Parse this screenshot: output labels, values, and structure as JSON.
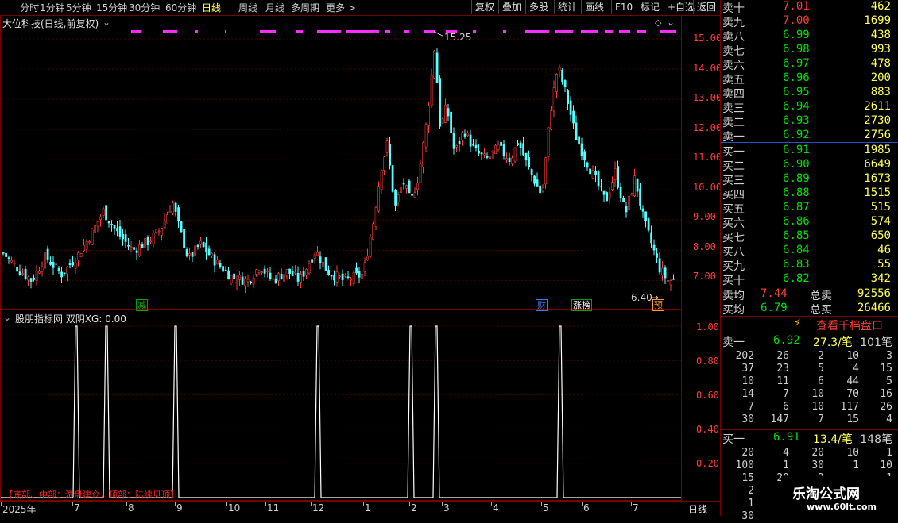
{
  "toolbar": {
    "periods": [
      "分时",
      "1分钟",
      "5分钟",
      "15分钟",
      "30分钟",
      "60分钟",
      "日线",
      "周线",
      "月线",
      "多周期",
      "更多 >"
    ],
    "active_period": "日线",
    "buttons": [
      "复权",
      "叠加",
      "多股",
      "统计",
      "画线",
      "F10",
      "标记",
      "+自选",
      "返回"
    ]
  },
  "main_chart": {
    "title": "大位科技(日线,前复权)",
    "high_label": "15.25",
    "low_label": "6.40",
    "price_axis": [
      "15.00",
      "14.00",
      "13.00",
      "12.00",
      "11.00",
      "10.00",
      "9.00",
      "8.00",
      "7.00"
    ],
    "markers": [
      {
        "text": "减",
        "color": "#00c000"
      },
      {
        "text": "财",
        "color": "#3a7cff"
      },
      {
        "text": "涨榜",
        "color": "#ffffff"
      },
      {
        "text": "预",
        "color": "#ff9a2e"
      }
    ]
  },
  "indicator": {
    "title": "股朋指标网  双阴XG: 0.00",
    "axis": [
      "1.00",
      "0.80",
      "0.60",
      "0.40",
      "0.20"
    ],
    "note": "【底部、中部：洗盘建仓，顶部：陆续见顶】"
  },
  "date_axis": {
    "labels": [
      "2025年",
      "7",
      "8",
      "9",
      "10",
      "11",
      "12",
      "1",
      "2",
      "3",
      "4",
      "5",
      "6",
      "7"
    ],
    "period_tab": "日线"
  },
  "order_book": {
    "asks": [
      {
        "label": "卖十",
        "price": "7.01",
        "vol": "462"
      },
      {
        "label": "卖九",
        "price": "7.00",
        "vol": "1699"
      },
      {
        "label": "卖八",
        "price": "6.99",
        "vol": "438"
      },
      {
        "label": "卖七",
        "price": "6.98",
        "vol": "993"
      },
      {
        "label": "卖六",
        "price": "6.97",
        "vol": "478"
      },
      {
        "label": "卖五",
        "price": "6.96",
        "vol": "200"
      },
      {
        "label": "卖四",
        "price": "6.95",
        "vol": "883"
      },
      {
        "label": "卖三",
        "price": "6.94",
        "vol": "2611"
      },
      {
        "label": "卖二",
        "price": "6.93",
        "vol": "2730"
      },
      {
        "label": "卖一",
        "price": "6.92",
        "vol": "2756"
      }
    ],
    "bids": [
      {
        "label": "买一",
        "price": "6.91",
        "vol": "1985"
      },
      {
        "label": "买二",
        "price": "6.90",
        "vol": "6649"
      },
      {
        "label": "买三",
        "price": "6.89",
        "vol": "1673"
      },
      {
        "label": "买四",
        "price": "6.88",
        "vol": "1515"
      },
      {
        "label": "买五",
        "price": "6.87",
        "vol": "515"
      },
      {
        "label": "买六",
        "price": "6.86",
        "vol": "574"
      },
      {
        "label": "买七",
        "price": "6.85",
        "vol": "650"
      },
      {
        "label": "买八",
        "price": "6.84",
        "vol": "46"
      },
      {
        "label": "买九",
        "price": "6.83",
        "vol": "55"
      },
      {
        "label": "买十",
        "price": "6.82",
        "vol": "342"
      }
    ],
    "avg_sell_label": "卖均",
    "avg_sell": "7.44",
    "total_sell_label": "总卖",
    "total_sell": "92556",
    "avg_buy_label": "买均",
    "avg_buy": "6.79",
    "total_buy_label": "总买",
    "total_buy": "26466",
    "view_button": "查看千档盘口",
    "sell1": {
      "label": "卖一",
      "price": "6.92",
      "per": "27.3/笔",
      "count": "101笔"
    },
    "sell_queue": [
      [
        "202",
        "26",
        "2",
        "10",
        "3"
      ],
      [
        "37",
        "23",
        "5",
        "4",
        "15"
      ],
      [
        "10",
        "11",
        "6",
        "44",
        "5"
      ],
      [
        "14",
        "7",
        "10",
        "70",
        "16"
      ],
      [
        "7",
        "6",
        "10",
        "117",
        "26"
      ],
      [
        "30",
        "147",
        "7",
        "15",
        "4"
      ]
    ],
    "buy1": {
      "label": "买一",
      "price": "6.91",
      "per": "13.4/笔",
      "count": "148笔"
    },
    "buy_queue": [
      [
        "20",
        "4",
        "20",
        "10",
        "1"
      ],
      [
        "100",
        "1",
        "30",
        "1",
        "10"
      ],
      [
        "15",
        "20",
        "2",
        "",
        "1"
      ],
      [
        "2",
        "",
        "",
        "",
        ""
      ],
      [
        "1",
        "",
        "",
        "",
        ""
      ],
      [
        "30",
        "",
        "",
        "",
        ""
      ]
    ],
    "watermark": "乐淘公式网",
    "watermark_url": "www.60lt.com"
  },
  "chart_data": {
    "type": "candlestick",
    "price_range": [
      6.4,
      15.25
    ],
    "indicator_signals_at_month": [
      "7",
      "7",
      "9",
      "12",
      "2",
      "2",
      "5"
    ]
  }
}
